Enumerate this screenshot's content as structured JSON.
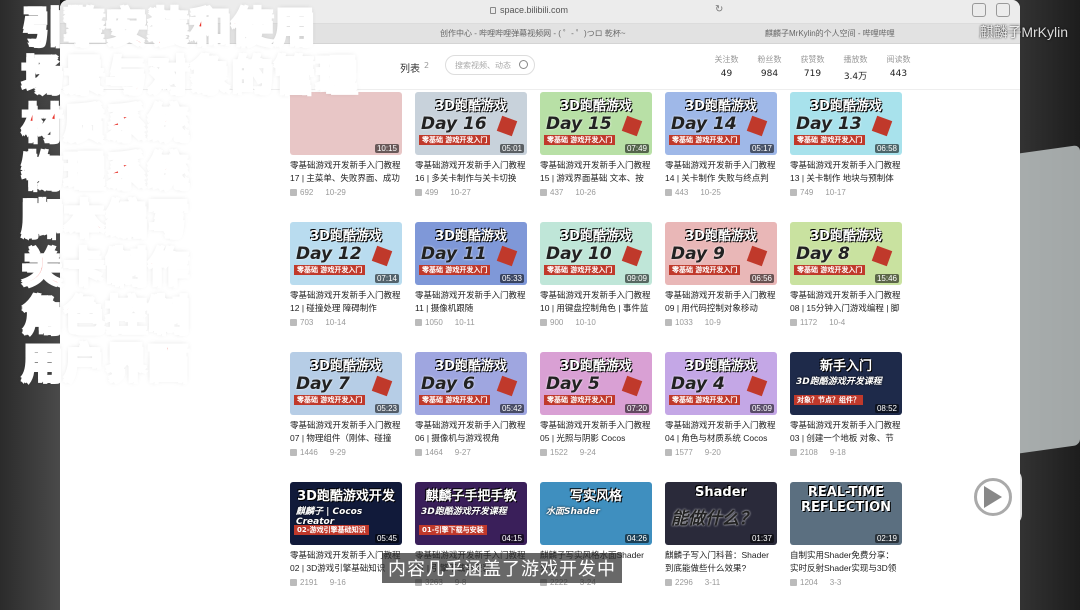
{
  "browser": {
    "url": "space.bilibili.com",
    "tabs": [
      "创作中心 - 哔哩哔哩弹幕视频网 - ( ゜- ゜)つロ 乾杯~",
      "麒麟子MrKylin的个人空间 - 哔哩哔哩"
    ]
  },
  "profile": {
    "list_tab": "列表",
    "list_count": "2",
    "search_placeholder": "搜索视频、动态",
    "stats": [
      {
        "label": "关注数",
        "value": "49"
      },
      {
        "label": "粉丝数",
        "value": "984"
      },
      {
        "label": "获赞数",
        "value": "719"
      },
      {
        "label": "播放数",
        "value": "3.4万"
      },
      {
        "label": "阅读数",
        "value": "443"
      }
    ]
  },
  "watermark": {
    "user": "麒麟子MrKylin",
    "logo": "bilibili"
  },
  "overlay_lines": [
    "引擎安装和使用",
    "场景与对象的管理",
    "材质系统",
    "物理系统",
    "脚本编写",
    "关卡制作",
    "角色控制",
    "用户界面"
  ],
  "subtitle": "内容几乎涵盖了游戏开发中",
  "videos": [
    {
      "thumb_title": "3D跑酷游戏",
      "day": "Day 16",
      "thumb_sub": "零基础 游戏开发入门",
      "duration": "05:01",
      "title": "零基础游戏开发新手入门教程16 | 多关卡制作与关卡切换",
      "plays": "499",
      "date": "10-27",
      "bg": "#c8d2db"
    },
    {
      "thumb_title": "3D跑酷游戏",
      "day": "Day 15",
      "thumb_sub": "零基础 游戏开发入门",
      "duration": "07:49",
      "title": "零基础游戏开发新手入门教程15 | 游戏界面基础 文本、按钮",
      "plays": "437",
      "date": "10-26",
      "bg": "#b8e0a6"
    },
    {
      "thumb_title": "3D跑酷游戏",
      "day": "Day 14",
      "thumb_sub": "零基础 游戏开发入门",
      "duration": "05:17",
      "title": "零基础游戏开发新手入门教程14 | 关卡制作 失败与终点判定",
      "plays": "443",
      "date": "10-25",
      "bg": "#9fb8e8"
    },
    {
      "thumb_title": "3D跑酷游戏",
      "day": "Day 13",
      "thumb_sub": "零基础 游戏开发入门",
      "duration": "06:58",
      "title": "零基础游戏开发新手入门教程13 | 关卡制作 地块与预制体",
      "plays": "749",
      "date": "10-17",
      "bg": "#a8e2ec"
    },
    {
      "thumb_title": "3D跑酷游戏",
      "day": "Day 12",
      "thumb_sub": "零基础 游戏开发入门",
      "duration": "07:14",
      "title": "零基础游戏开发新手入门教程12 | 碰撞处理 障碍制作",
      "plays": "703",
      "date": "10-14",
      "bg": "#b9dcef"
    },
    {
      "thumb_title": "3D跑酷游戏",
      "day": "Day 11",
      "thumb_sub": "零基础 游戏开发入门",
      "duration": "05:33",
      "title": "零基础游戏开发新手入门教程11 | 摄像机跟随",
      "plays": "1050",
      "date": "10-11",
      "bg": "#7f98d8"
    },
    {
      "thumb_title": "3D跑酷游戏",
      "day": "Day 10",
      "thumb_sub": "零基础 游戏开发入门",
      "duration": "09:09",
      "title": "零基础游戏开发新手入门教程10 | 用键盘控制角色 | 事件监",
      "plays": "900",
      "date": "10-10",
      "bg": "#bfe6d8"
    },
    {
      "thumb_title": "3D跑酷游戏",
      "day": "Day 9",
      "thumb_sub": "零基础 游戏开发入门",
      "duration": "06:56",
      "title": "零基础游戏开发新手入门教程09 | 用代码控制对象移动",
      "plays": "1033",
      "date": "10-9",
      "bg": "#e9b7b7"
    },
    {
      "thumb_title": "3D跑酷游戏",
      "day": "Day 8",
      "thumb_sub": "零基础 游戏开发入门",
      "duration": "15:46",
      "title": "零基础游戏开发新手入门教程08 | 15分钟入门游戏编程 | 脚",
      "plays": "1172",
      "date": "10-4",
      "bg": "#c9e2a0"
    },
    {
      "thumb_title": "3D跑酷游戏",
      "day": "Day 7",
      "thumb_sub": "零基础 游戏开发入门",
      "duration": "05:23",
      "title": "零基础游戏开发新手入门教程07 | 物理组件（刚体、碰撞",
      "plays": "1446",
      "date": "9-29",
      "bg": "#b6cde6"
    },
    {
      "thumb_title": "3D跑酷游戏",
      "day": "Day 6",
      "thumb_sub": "零基础 游戏开发入门",
      "duration": "05:42",
      "title": "零基础游戏开发新手入门教程06 | 摄像机与游戏视角",
      "plays": "1464",
      "date": "9-27",
      "bg": "#9fa6e0"
    },
    {
      "thumb_title": "3D跑酷游戏",
      "day": "Day 5",
      "thumb_sub": "零基础 游戏开发入门",
      "duration": "07:20",
      "title": "零基础游戏开发新手入门教程05 | 光照与阴影 Cocos",
      "plays": "1522",
      "date": "9-24",
      "bg": "#d9a0d4"
    },
    {
      "thumb_title": "3D跑酷游戏",
      "day": "Day 4",
      "thumb_sub": "零基础 游戏开发入门",
      "duration": "05:09",
      "title": "零基础游戏开发新手入门教程04 | 角色与材质系统 Cocos",
      "plays": "1577",
      "date": "9-20",
      "bg": "#c4a7e6"
    },
    {
      "thumb_title": "新手入门",
      "day": "3D跑酷游戏开发课程",
      "thumb_sub": "对象？节点？组件？",
      "duration": "08:52",
      "title": "零基础游戏开发新手入门教程03 | 创建一个地板 对象、节",
      "plays": "2108",
      "date": "9-18",
      "bg": "#1e2a4a"
    },
    {
      "thumb_title": "3D跑酷游戏开发",
      "day": "麒麟子 | Cocos Creator",
      "thumb_sub": "02-游戏引擎基础知识",
      "duration": "05:45",
      "title": "零基础游戏开发新手入门教程02 | 3D游戏引擎基础知识",
      "plays": "2191",
      "date": "9-16",
      "bg": "#111a3a"
    },
    {
      "thumb_title": "麒麟子手把手教",
      "day": "3D跑酷游戏开发课程",
      "thumb_sub": "01-引擎下载与安装",
      "duration": "04:15",
      "title": "零基础游戏开发新手入门教程01 | 引擎下载与安装",
      "plays": "3263",
      "date": "9-8",
      "bg": "#3a1f5a"
    },
    {
      "thumb_title": "写实风格",
      "day": "水面Shader",
      "thumb_sub": "",
      "duration": "04:26",
      "title": "麒麟子写实风格水面Shader分享",
      "plays": "2222",
      "date": "3-24",
      "bg": "#3f8fbf"
    },
    {
      "thumb_title": "Shader",
      "day": "能做什么？",
      "thumb_sub": "",
      "duration": "01:37",
      "title": "麒麟子写入门科普：Shader到底能做些什么效果?",
      "plays": "2296",
      "date": "3-11",
      "bg": "#2a2a3a"
    },
    {
      "thumb_title": "REAL-TIME REFLECTION",
      "day": "",
      "thumb_sub": "",
      "duration": "02:19",
      "title": "自制实用Shader免费分享：实时反射Shader实现与3D领域",
      "plays": "1204",
      "date": "3-3",
      "bg": "#5b6f80"
    }
  ],
  "first_row_partial": [
    {
      "duration": "10:15",
      "title": "零基础游戏开发新手入门教程17 | 主菜单、失败界面、成功",
      "plays": "692",
      "date": "10-29"
    }
  ]
}
